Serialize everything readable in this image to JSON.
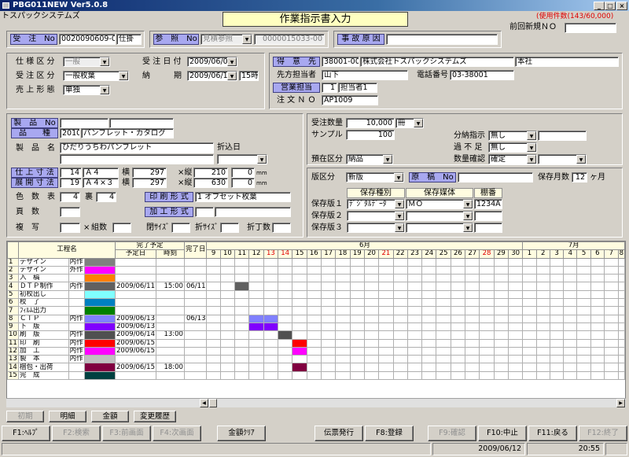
{
  "window": {
    "title": "PBG011NEW  Ver5.0.8",
    "company": "トスパックシステムズ",
    "form_title": "作業指示書入力",
    "usage": "(使用件数(143/60,000)",
    "prev_new": "前回新規ＮＯ"
  },
  "order": {
    "label": "受　注　No",
    "no": "0020090609-009",
    "type": "仕掛",
    "ref_label": "参　照　No",
    "ref_select": "見積参照",
    "ref_no": "0000015033-00",
    "accident_label": "事 故 原 因",
    "accident_value": ""
  },
  "spec": {
    "shiyo_label": "仕 様 区 分",
    "shiyo": "一般",
    "juchu_kubun_label": "受 注 区 分",
    "juchu_kubun": "一般枚葉",
    "uriage_label": "売 上 形 態",
    "uriage": "単独",
    "juchu_date_label": "受 注 日 付",
    "juchu_date": "2009/06/09",
    "nouki_label": "納　　　期",
    "nouki": "2009/06/15",
    "nouki_time": "15時"
  },
  "customer": {
    "label": "得　意　先",
    "code": "38001-000",
    "name": "株式会社トスパックシステムズ",
    "branch": "本社",
    "contact_label": "先方担当者",
    "contact": "山下",
    "tel_label": "電話番号",
    "tel": "03-38001",
    "sales_label": "営業担当",
    "sales_code": "1",
    "sales_name": "担当者1",
    "order_no_label": "注 文 Ｎ Ｏ",
    "order_no": "AP1009"
  },
  "product": {
    "no_label": "製　品　No",
    "type_label": "品　　種",
    "type_code": "2010",
    "type_name": "パンフレット・カタログ",
    "name_label": "製　品　名",
    "name": "ひだりうちわパンフレット",
    "fold_date_label": "折込日",
    "finish_label": "仕 上 寸 法",
    "finish_code": "14",
    "finish_size": "Ａ４",
    "yoko_label": "横",
    "finish_w": "297",
    "tate_label": "×縦",
    "finish_h": "210",
    "finish_mm": "0",
    "unit": "mm",
    "develop_label": "展 開 寸 法",
    "dev_code": "19",
    "dev_size": "Ａ４×３",
    "dev_w": "297",
    "dev_h": "630",
    "dev_mm": "0",
    "color_label": "色　数　表",
    "color_front": "4",
    "back_label": "裏",
    "color_back": "4",
    "print_form_label": "印 刷 形 式",
    "print_form": "1 オフセット枚葉",
    "pages_label": "頁　数",
    "proc_form_label": "加 工 形 式",
    "copy_label": "複　写",
    "x_label": "×",
    "kumi_label": "組数",
    "bind_label": "閉ｻｲｽﾞ",
    "fold_label": "折ｻｲｽﾞ",
    "fold_count_label": "折丁数"
  },
  "qty": {
    "label": "受注数量",
    "value": "10,000",
    "unit": "冊",
    "sample_label": "サンプル",
    "sample": "100",
    "split_label": "分納指示",
    "split": "無し",
    "over_label": "過 不 足",
    "over": "無し",
    "confirm_label": "数量確認",
    "confirm": "確定",
    "deposit_label": "預在区分",
    "deposit": "納品"
  },
  "plate": {
    "label": "版区分",
    "value": "新版",
    "manuscript_label": "原　稿　No",
    "keep_label": "保存月数",
    "keep": "12",
    "keep_unit": "ヶ月",
    "type_header": "保存種別",
    "media_header": "保存媒体",
    "shelf_header": "棚番",
    "rows": [
      {
        "label": "保存版１",
        "type": "ﾃﾞｼﾞﾀﾙﾃﾞｰﾀ",
        "media": "ＭＯ",
        "shelf": "1234A"
      },
      {
        "label": "保存版２",
        "type": "",
        "media": "",
        "shelf": ""
      },
      {
        "label": "保存版３",
        "type": "",
        "media": "",
        "shelf": ""
      }
    ]
  },
  "gantt": {
    "process_header": "工程名",
    "plan_header": "完了予定",
    "plan_date_header": "予定日",
    "plan_time_header": "時刻",
    "done_header": "完了日",
    "month1": "6月",
    "month2": "7月",
    "days": [
      {
        "d": "9",
        "red": false
      },
      {
        "d": "10",
        "red": false
      },
      {
        "d": "11",
        "red": false
      },
      {
        "d": "12",
        "red": false
      },
      {
        "d": "13",
        "red": true
      },
      {
        "d": "14",
        "red": true
      },
      {
        "d": "15",
        "red": false
      },
      {
        "d": "16",
        "red": false
      },
      {
        "d": "17",
        "red": false
      },
      {
        "d": "18",
        "red": false
      },
      {
        "d": "19",
        "red": false
      },
      {
        "d": "20",
        "red": false
      },
      {
        "d": "21",
        "red": true
      },
      {
        "d": "22",
        "red": false
      },
      {
        "d": "23",
        "red": false
      },
      {
        "d": "24",
        "red": false
      },
      {
        "d": "25",
        "red": false
      },
      {
        "d": "26",
        "red": false
      },
      {
        "d": "27",
        "red": false
      },
      {
        "d": "28",
        "red": true
      },
      {
        "d": "29",
        "red": false
      },
      {
        "d": "30",
        "red": false
      },
      {
        "d": "1",
        "red": false
      },
      {
        "d": "2",
        "red": false
      },
      {
        "d": "3",
        "red": false
      },
      {
        "d": "4",
        "red": false
      },
      {
        "d": "5",
        "red": false
      },
      {
        "d": "6",
        "red": false
      },
      {
        "d": "7",
        "red": false
      },
      {
        "d": "8",
        "red": false
      }
    ],
    "rows": [
      {
        "no": "1",
        "name": "デザイン",
        "loc": "内作",
        "color": "#808080",
        "plan": "",
        "time": "",
        "done": "",
        "bars": []
      },
      {
        "no": "2",
        "name": "デザイン",
        "loc": "外作",
        "color": "#ff00ff",
        "plan": "",
        "time": "",
        "done": "",
        "bars": []
      },
      {
        "no": "3",
        "name": "入　稿",
        "loc": "",
        "color": "#ff8000",
        "plan": "",
        "time": "",
        "done": "",
        "bars": []
      },
      {
        "no": "4",
        "name": "ＤＴＰ制作",
        "loc": "内作",
        "color": "#606060",
        "plan": "2009/06/11",
        "time": "15:00",
        "done": "06/11",
        "bars": [
          2
        ]
      },
      {
        "no": "5",
        "name": "初校出し",
        "loc": "",
        "color": "#80ffff",
        "plan": "",
        "time": "",
        "done": "",
        "bars": []
      },
      {
        "no": "6",
        "name": "校　了",
        "loc": "",
        "color": "#0080c0",
        "plan": "",
        "time": "",
        "done": "",
        "bars": []
      },
      {
        "no": "7",
        "name": "ﾌｨﾙﾑ出力",
        "loc": "",
        "color": "#008000",
        "plan": "",
        "time": "",
        "done": "",
        "bars": []
      },
      {
        "no": "8",
        "name": "ＣＴＰ",
        "loc": "内作",
        "color": "#8080ff",
        "plan": "2009/06/13",
        "time": "",
        "done": "06/13",
        "bars": [
          3,
          4
        ]
      },
      {
        "no": "9",
        "name": "下　版",
        "loc": "",
        "color": "#8000ff",
        "plan": "2009/06/13",
        "time": "",
        "done": "",
        "bars": [
          3,
          4
        ]
      },
      {
        "no": "10",
        "name": "刷　版",
        "loc": "内作",
        "color": "#505050",
        "plan": "2009/06/14",
        "time": "13:00",
        "done": "",
        "bars": [
          5
        ]
      },
      {
        "no": "11",
        "name": "印　刷",
        "loc": "内作",
        "color": "#ff0000",
        "plan": "2009/06/15",
        "time": "",
        "done": "",
        "bars": [
          6
        ]
      },
      {
        "no": "12",
        "name": "加　工",
        "loc": "内作",
        "color": "#ff00ff",
        "plan": "2009/06/15",
        "time": "",
        "done": "",
        "bars": [
          6
        ]
      },
      {
        "no": "13",
        "name": "製　本",
        "loc": "内作",
        "color": "#c0c0c0",
        "plan": "",
        "time": "",
        "done": "",
        "bars": []
      },
      {
        "no": "14",
        "name": "梱包・出荷",
        "loc": "",
        "color": "#800040",
        "plan": "2009/06/15",
        "time": "18:00",
        "done": "",
        "bars": [
          6
        ]
      },
      {
        "no": "15",
        "name": "完　成",
        "loc": "",
        "color": "#004040",
        "plan": "",
        "time": "",
        "done": "",
        "bars": []
      }
    ]
  },
  "bottom_buttons": {
    "shoki": "初期",
    "meisai": "明細",
    "kingaku": "金額",
    "henko": "変更履歴"
  },
  "fkeys": {
    "f1": "F1:ﾍﾙﾌﾟ",
    "f2": "F2:検索",
    "f3": "F3:前画面",
    "f4": "F4:次画面",
    "kingaku_clear": "金額ｸﾘｱ",
    "denpyo": "伝票発行",
    "f8": "F8:登録",
    "f9": "F9:確認",
    "f10": "F10:中止",
    "f11": "F11:戻る",
    "f12": "F12:終了"
  },
  "status": {
    "date": "2009/06/12",
    "time": "20:55"
  }
}
